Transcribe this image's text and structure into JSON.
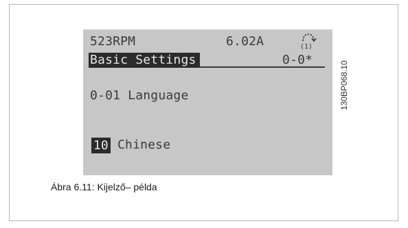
{
  "display": {
    "speed": "523RPM",
    "current": "6.02A",
    "hand_mode_indicator": "(1)",
    "menu_title": "Basic Settings",
    "param_code": "0-0*",
    "param_line": "0-01 Language",
    "option_index": "10",
    "option_name": "Chinese"
  },
  "figure": {
    "side_code": "130BP068.10",
    "caption": "Ábra 6.11: Kijelző– példa"
  },
  "colors": {
    "lcd_background": "#c7c7c7",
    "lcd_text": "#3a3a3a",
    "highlight_background": "#2b2b2b"
  },
  "icons": {
    "hand_mode": "hand-mode-icon"
  }
}
